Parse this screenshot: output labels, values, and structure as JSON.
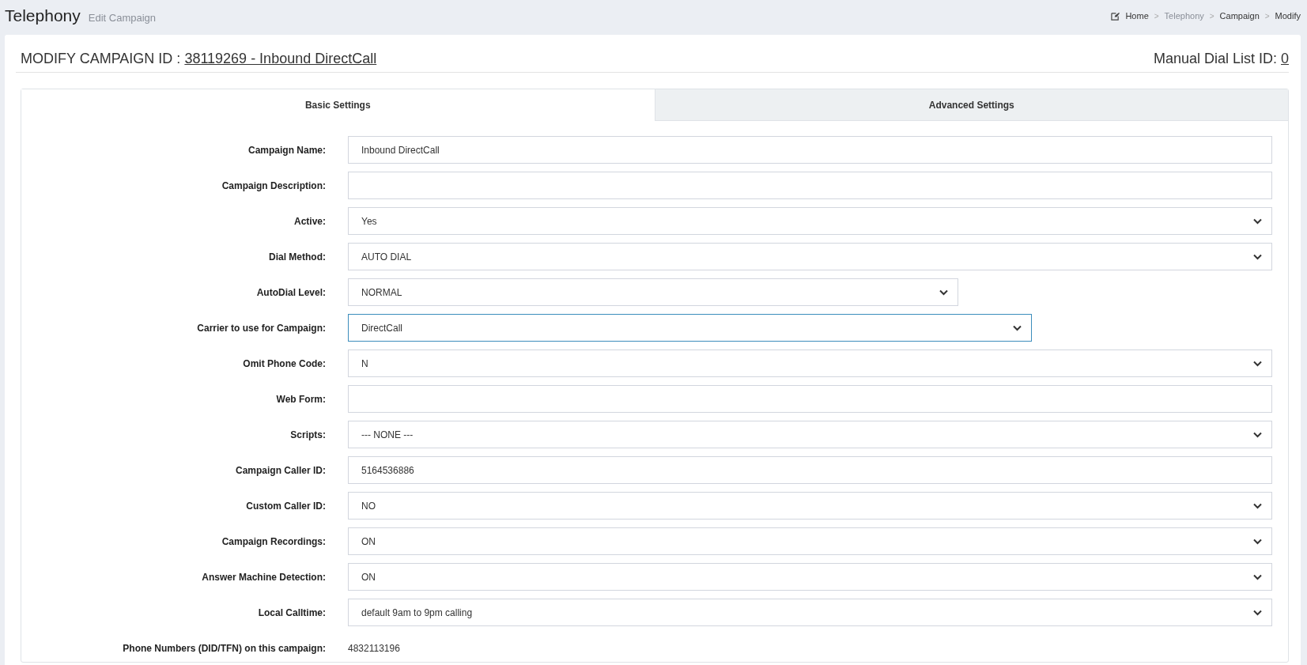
{
  "header": {
    "title": "Telephony",
    "subtitle": "Edit Campaign"
  },
  "breadcrumb_separator": ">",
  "breadcrumb": [
    {
      "label": "Home",
      "kind": "link"
    },
    {
      "label": "Telephony",
      "kind": "muted"
    },
    {
      "label": "Campaign",
      "kind": "link"
    },
    {
      "label": "Modify",
      "kind": "current"
    }
  ],
  "campaign_heading": {
    "label": "MODIFY CAMPAIGN ID :",
    "link": "38119269 - Inbound DirectCall"
  },
  "manual_dial": {
    "label": "Manual Dial List ID:",
    "link": "0"
  },
  "tabs": [
    {
      "label": "Basic Settings",
      "selected": true
    },
    {
      "label": "Advanced Settings",
      "selected": false
    }
  ],
  "fields": [
    {
      "label": "Campaign Name:",
      "kind": "text",
      "value": "Inbound DirectCall",
      "focused": false
    },
    {
      "label": "Campaign Description:",
      "kind": "text",
      "focused": false
    },
    {
      "label": "Active:",
      "kind": "select",
      "value": "Yes",
      "focused": false
    },
    {
      "label": "Dial Method:",
      "kind": "select",
      "value": "AUTO DIAL",
      "focused": false
    },
    {
      "label": "AutoDial Level:",
      "kind": "select-narrow",
      "value": "NORMAL",
      "focused": false
    },
    {
      "label": "Carrier to use for Campaign:",
      "kind": "select-medium",
      "value": "DirectCall",
      "focused": true
    },
    {
      "label": "Omit Phone Code:",
      "kind": "select",
      "value": "N",
      "focused": false
    },
    {
      "label": "Web Form:",
      "kind": "text",
      "focused": false
    },
    {
      "label": "Scripts:",
      "kind": "select",
      "value": "--- NONE ---",
      "focused": false
    },
    {
      "label": "Campaign Caller ID:",
      "kind": "text",
      "value": "5164536886",
      "focused": false
    },
    {
      "label": "Custom Caller ID:",
      "kind": "select",
      "value": "NO",
      "focused": false
    },
    {
      "label": "Campaign Recordings:",
      "kind": "select",
      "value": "ON",
      "focused": false
    },
    {
      "label": "Answer Machine Detection:",
      "kind": "select",
      "value": "ON",
      "focused": false
    },
    {
      "label": "Local Calltime:",
      "kind": "select",
      "value": "default 9am to 9pm calling",
      "focused": false
    },
    {
      "label": "Phone Numbers (DID/TFN) on this campaign:",
      "kind": "static",
      "value": "4832113196"
    }
  ]
}
